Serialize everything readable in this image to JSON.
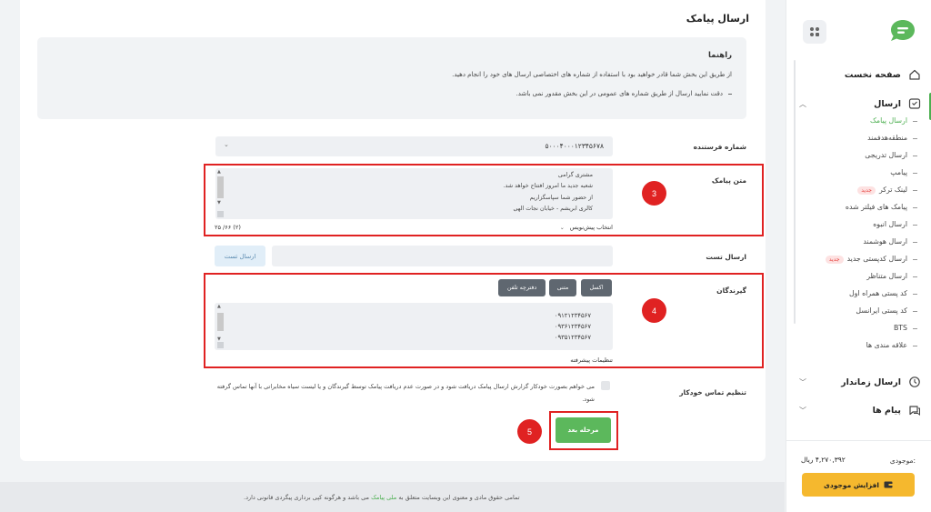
{
  "page_title": "ارسال پیامک",
  "guide": {
    "title": "راهنما",
    "line1": "از طریق این بخش شما قادر خواهید بود با استفاده از شماره های اختصاصی ارسال های خود را انجام دهید.",
    "line2": "دقت نمایید ارسال از طریق شماره های عمومی در این بخش مقدور نمی باشد."
  },
  "form": {
    "sender_label": "شماره فرستنده",
    "sender_value": "۵۰۰۰۴۰۰۰۱۲۳۴۵۶۷۸",
    "message_label": "متن پیامک",
    "message_lines": [
      "مشتری گرامی",
      "شعبه جدید ما امروز افتتاح خواهد شد.",
      "از حضور شما سپاسگزاریم",
      "کالری ابریشم - خیابان نجات الهی"
    ],
    "message_counter": "(۲) ۶۶/ ۲۵",
    "presets_label": "انتخاب پیش‌نویس",
    "test_label": "ارسال تست",
    "test_button": "ارسال تست",
    "receivers_label": "گیرندگان",
    "receiver_buttons": [
      "اکسل",
      "متنی",
      "دفترچه تلفن"
    ],
    "receivers": [
      "۰۹۱۲۱۲۳۴۵۶۷",
      "۰۹۳۶۱۲۳۴۵۶۷",
      "۰۹۳۵۱۲۳۴۵۶۷"
    ],
    "advanced_label": "تنظیمات پیشرفته",
    "auto_contact_label": "تنظیم تماس خودکار",
    "auto_contact_text": "می خواهم بصورت خودکار گزارش ارسال پیامک دریافت شود و در صورت عدم دریافت پیامک توسط گیرندگان و یا لیست سیاه مخابراتی با آنها تماس گرفته شود.",
    "next_button": "مرحله بعد"
  },
  "annotations": [
    "3",
    "4",
    "5"
  ],
  "footer": {
    "before": "تمامی حقوق مادی و معنوی این وبسایت متعلق به",
    "brand": "ملی پیامک",
    "after": "می باشد و هرگونه کپی برداری پیگردی قانونی دارد."
  },
  "sidebar": {
    "home": "صفحه نخست",
    "send": "ارسال",
    "send_items": [
      {
        "label": "ارسال پیامک",
        "badge": ""
      },
      {
        "label": "منطقه‌هدفمند",
        "badge": ""
      },
      {
        "label": "ارسال تدریجی",
        "badge": ""
      },
      {
        "label": "پیامپ",
        "badge": ""
      },
      {
        "label": "لینک ترکر",
        "badge": "جدید"
      },
      {
        "label": "پیامک های فیلتر شده",
        "badge": ""
      },
      {
        "label": "ارسال انبوه",
        "badge": ""
      },
      {
        "label": "ارسال هوشمند",
        "badge": ""
      },
      {
        "label": "ارسال کدپستی جدید",
        "badge": "جدید"
      },
      {
        "label": "ارسال متناظر",
        "badge": ""
      },
      {
        "label": "کد پستی همراه اول",
        "badge": ""
      },
      {
        "label": "کد پستی ایرانسل",
        "badge": ""
      },
      {
        "label": "BTS",
        "badge": ""
      },
      {
        "label": "علاقه مندی ها",
        "badge": ""
      }
    ],
    "scheduled": "ارسال زماندار",
    "messages": "پیام ها",
    "balance_label": "موجودی:",
    "balance_value": "۴,۲۷۰,۳۹۲ ریال",
    "increase_button": "افزایش موجودی"
  },
  "colors": {
    "accent": "#4caf50",
    "annotation_red": "#e02222",
    "cta_yellow": "#f5b82e"
  }
}
